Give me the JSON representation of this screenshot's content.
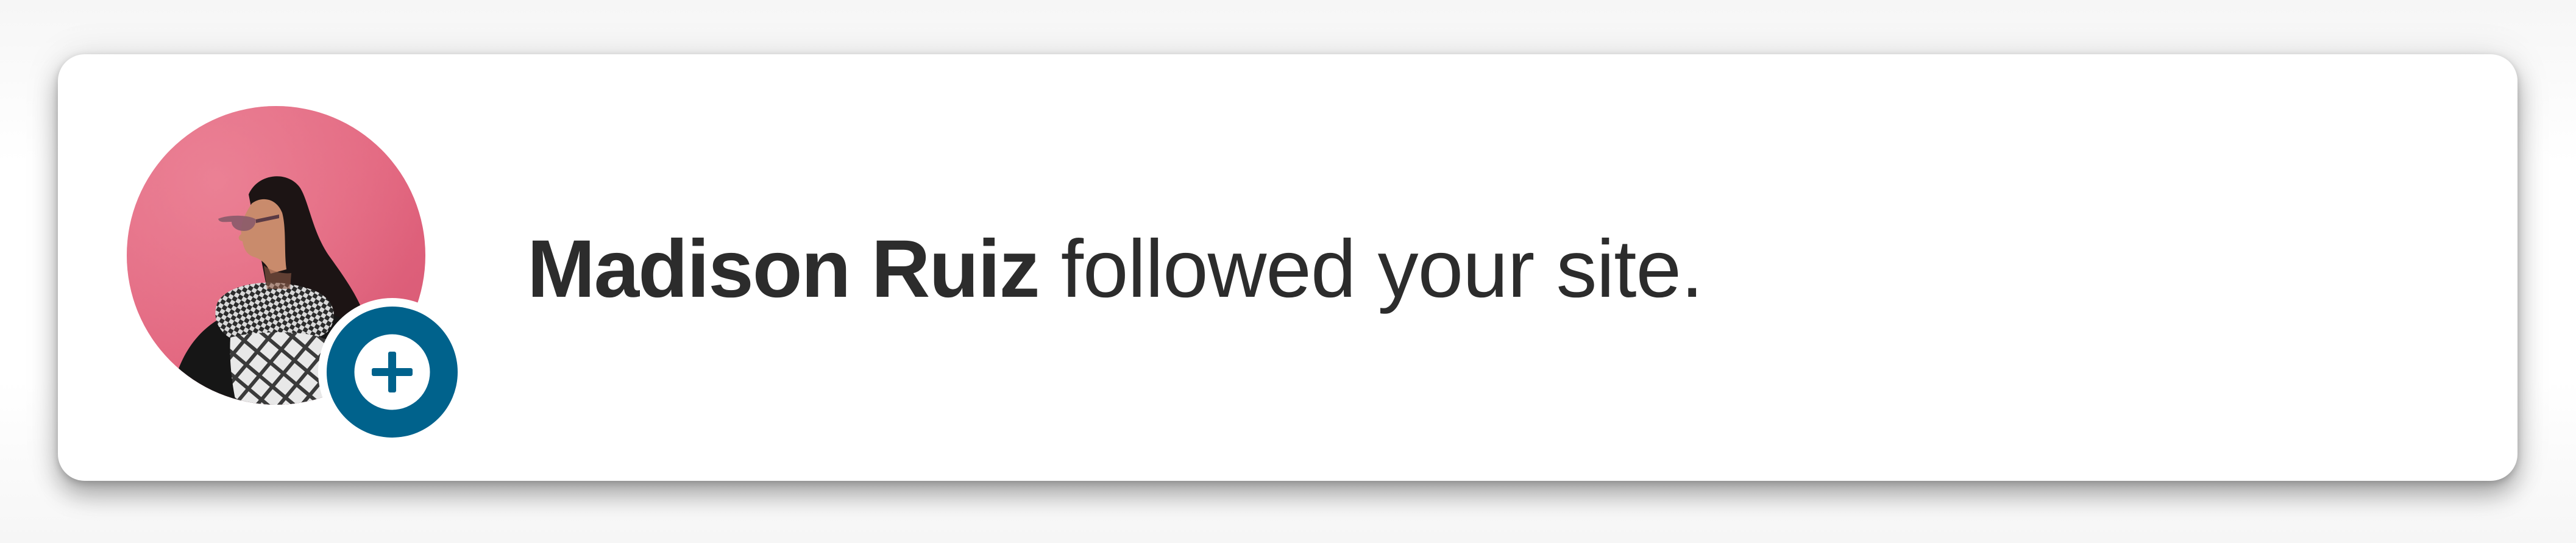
{
  "notification": {
    "avatar_icon": "user-photo",
    "badge_icon": "plus-circle-icon",
    "actor_name": "Madison Ruiz",
    "action_text": " followed your site."
  },
  "colors": {
    "badge_background": "#00628c",
    "badge_symbol": "#00628c",
    "text": "#2c2c2c",
    "card_background": "#ffffff"
  }
}
